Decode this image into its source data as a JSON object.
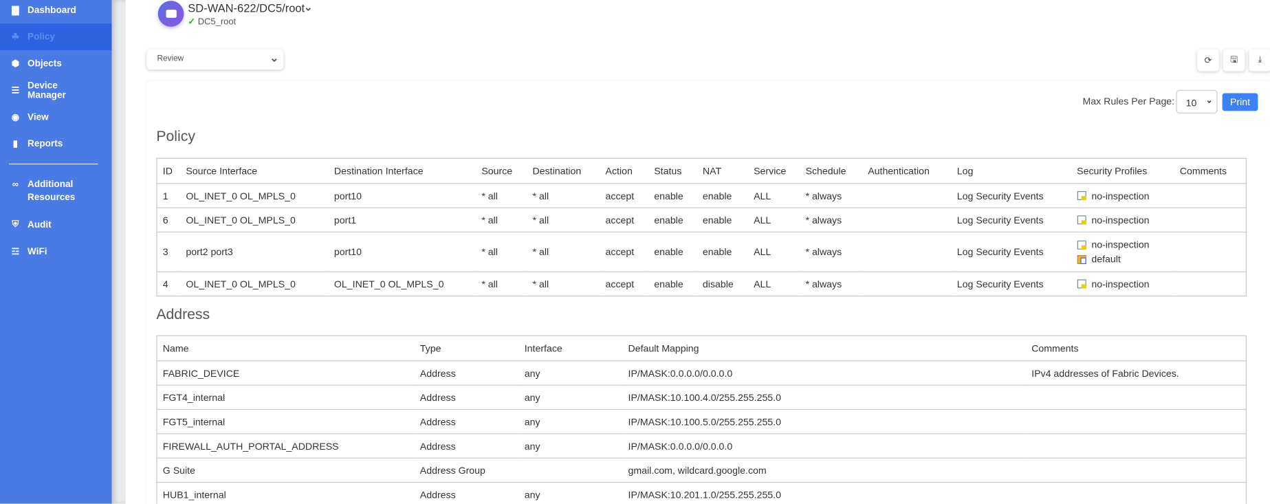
{
  "sidebar": {
    "items": [
      {
        "label": "Dashboard",
        "icon": "bar-chart-icon"
      },
      {
        "label": "Policy",
        "icon": "policy-icon",
        "active": true
      },
      {
        "label": "Objects",
        "icon": "cube-icon"
      },
      {
        "label": "Device Manager",
        "icon": "server-icon"
      },
      {
        "label": "View",
        "icon": "eye-icon"
      },
      {
        "label": "Reports",
        "icon": "file-icon"
      },
      {
        "label": "Additional Resources",
        "icon": "link-icon"
      },
      {
        "label": "Audit",
        "icon": "shield-icon"
      },
      {
        "label": "WiFi",
        "icon": "wifi-icon"
      }
    ]
  },
  "header": {
    "title": "SD-WAN-622/DC5/root",
    "subtitle": "DC5_root"
  },
  "toolbar": {
    "view_select": "Review",
    "max_rules_label": "Max Rules Per Page:",
    "max_rules_value": "10",
    "print_label": "Print"
  },
  "policy": {
    "heading": "Policy",
    "columns": [
      "ID",
      "Source Interface",
      "Destination Interface",
      "Source",
      "Destination",
      "Action",
      "Status",
      "NAT",
      "Service",
      "Schedule",
      "Authentication",
      "Log",
      "Security Profiles",
      "Comments"
    ],
    "rows": [
      {
        "cells": [
          "1",
          "OL_INET_0 OL_MPLS_0",
          "port10",
          "* all",
          "* all",
          "accept",
          "enable",
          "enable",
          "ALL",
          "* always",
          "",
          "Log Security Events"
        ],
        "profiles": [
          "no-inspection"
        ],
        "comments": ""
      },
      {
        "cells": [
          "6",
          "OL_INET_0 OL_MPLS_0",
          "port1",
          "* all",
          "* all",
          "accept",
          "enable",
          "enable",
          "ALL",
          "* always",
          "",
          "Log Security Events"
        ],
        "profiles": [
          "no-inspection"
        ],
        "comments": ""
      },
      {
        "cells": [
          "3",
          "port2 port3",
          "port10",
          "* all",
          "* all",
          "accept",
          "enable",
          "enable",
          "ALL",
          "* always",
          "",
          "Log Security Events"
        ],
        "profiles": [
          "no-inspection",
          "default"
        ],
        "comments": ""
      },
      {
        "cells": [
          "4",
          "OL_INET_0 OL_MPLS_0",
          "OL_INET_0 OL_MPLS_0",
          "* all",
          "* all",
          "accept",
          "enable",
          "disable",
          "ALL",
          "* always",
          "",
          "Log Security Events"
        ],
        "profiles": [
          "no-inspection"
        ],
        "comments": ""
      }
    ]
  },
  "address": {
    "heading": "Address",
    "columns": [
      "Name",
      "Type",
      "Interface",
      "Default Mapping",
      "Comments"
    ],
    "rows": [
      [
        "FABRIC_DEVICE",
        "Address",
        "any",
        "IP/MASK:0.0.0.0/0.0.0.0",
        "IPv4 addresses of Fabric Devices."
      ],
      [
        "FGT4_internal",
        "Address",
        "any",
        "IP/MASK:10.100.4.0/255.255.255.0",
        ""
      ],
      [
        "FGT5_internal",
        "Address",
        "any",
        "IP/MASK:10.100.5.0/255.255.255.0",
        ""
      ],
      [
        "FIREWALL_AUTH_PORTAL_ADDRESS",
        "Address",
        "any",
        "IP/MASK:0.0.0.0/0.0.0.0",
        ""
      ],
      [
        "G Suite",
        "Address Group",
        "",
        "gmail.com, wildcard.google.com",
        ""
      ],
      [
        "HUB1_internal",
        "Address",
        "any",
        "IP/MASK:10.201.1.0/255.255.255.0",
        ""
      ]
    ]
  }
}
